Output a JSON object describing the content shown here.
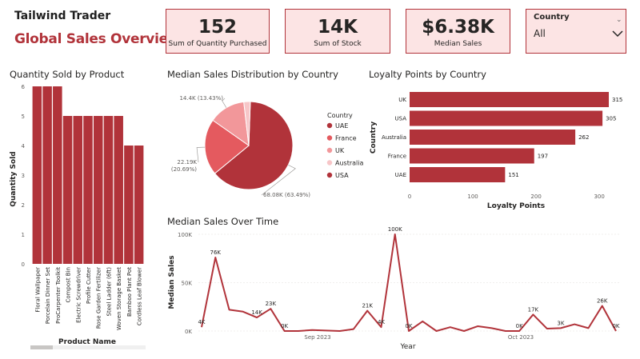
{
  "header": {
    "brand": "Tailwind Trader",
    "title": "Global Sales Overview"
  },
  "kpis": [
    {
      "value": "152",
      "label": "Sum of Quantity Purchased"
    },
    {
      "value": "14K",
      "label": "Sum of  Stock"
    },
    {
      "value": "$6.38K",
      "label": "Median Sales"
    }
  ],
  "slicer": {
    "label": "Country",
    "value": "All"
  },
  "colors": {
    "primary": "#b1333a",
    "red2": "#e45a5f",
    "pink": "#f2979a",
    "lightpink": "#f7c6c8",
    "card_bg": "#fce4e4"
  },
  "chart_data": [
    {
      "type": "bar",
      "title": "Quantity Sold by Product",
      "xlabel": "Product Name",
      "ylabel": "Quantity Sold",
      "categories": [
        "Floral Wallpaper",
        "Porcelain Dinner Set",
        "ProCarpenter Toolkit",
        "Compost Bin",
        "Electric Screwdriver",
        "Profile Cutter",
        "Rose Garden Fertilizer",
        "Steel Ladder (6ft)",
        "Woven Storage Basket",
        "Bamboo Plant Pot",
        "Cordless Leaf Blower"
      ],
      "values": [
        6,
        6,
        6,
        5,
        5,
        5,
        5,
        5,
        5,
        4,
        4
      ],
      "ylim": [
        0,
        6
      ],
      "yticks": [
        "0",
        "1",
        "2",
        "3",
        "4",
        "5",
        "6"
      ]
    },
    {
      "type": "pie",
      "title": "Median Sales Distribution by Country",
      "legend_title": "Country",
      "legend": [
        "UAE",
        "France",
        "UK",
        "Australia",
        "USA"
      ],
      "slices": [
        {
          "name": "USA",
          "value": 68080,
          "label": "68.08K (63.49%)"
        },
        {
          "name": "France",
          "value": 22190,
          "label": "22.19K (20.69%)"
        },
        {
          "name": "UK",
          "value": 14400,
          "label": "14.4K (13.43%)"
        },
        {
          "name": "Australia",
          "value": 2560,
          "label": ""
        }
      ]
    },
    {
      "type": "bar",
      "orientation": "horizontal",
      "title": "Loyalty Points by Country",
      "xlabel": "Loyalty Points",
      "ylabel": "Country",
      "categories": [
        "UK",
        "USA",
        "Australia",
        "France",
        "UAE"
      ],
      "values": [
        315,
        305,
        262,
        197,
        151
      ],
      "xlim": [
        0,
        315
      ],
      "xticks": [
        "0",
        "100",
        "200",
        "300"
      ]
    },
    {
      "type": "line",
      "title": "Median Sales Over Time",
      "xlabel": "Year",
      "ylabel": "Median Sales",
      "ylim": [
        0,
        100000
      ],
      "yticks": [
        "0K",
        "50K",
        "100K"
      ],
      "xticks": [
        "Sep 2023",
        "Oct 2023"
      ],
      "values": [
        4000,
        76000,
        22000,
        20000,
        14000,
        23000,
        0,
        0,
        1000,
        500,
        0,
        2000,
        21000,
        4000,
        100000,
        0,
        10000,
        0,
        4000,
        0,
        5000,
        3000,
        0,
        0,
        17000,
        2500,
        3000,
        7000,
        3000,
        26000,
        0
      ],
      "labels": [
        "4K",
        "76K",
        "",
        "",
        "14K",
        "23K",
        "0K",
        "",
        "",
        "",
        "",
        "",
        "21K",
        "4K",
        "100K",
        "0K",
        "",
        "",
        "",
        "",
        "",
        "",
        "",
        "0K",
        "17K",
        "",
        "3K",
        "",
        "",
        "26K",
        "0K"
      ]
    }
  ]
}
